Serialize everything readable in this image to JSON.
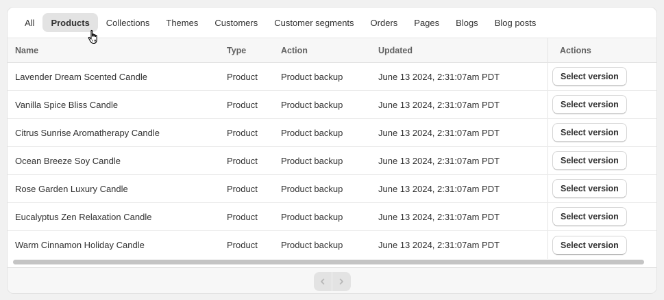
{
  "tabs": [
    {
      "label": "All",
      "active": false
    },
    {
      "label": "Products",
      "active": true
    },
    {
      "label": "Collections",
      "active": false
    },
    {
      "label": "Themes",
      "active": false
    },
    {
      "label": "Customers",
      "active": false
    },
    {
      "label": "Customer segments",
      "active": false
    },
    {
      "label": "Orders",
      "active": false
    },
    {
      "label": "Pages",
      "active": false
    },
    {
      "label": "Blogs",
      "active": false
    },
    {
      "label": "Blog posts",
      "active": false
    }
  ],
  "table": {
    "columns": {
      "name": "Name",
      "type": "Type",
      "action": "Action",
      "updated": "Updated",
      "actions": "Actions"
    },
    "rows": [
      {
        "name": "Lavender Dream Scented Candle",
        "type": "Product",
        "action": "Product backup",
        "updated": "June 13 2024, 2:31:07am PDT",
        "button": "Select version"
      },
      {
        "name": "Vanilla Spice Bliss Candle",
        "type": "Product",
        "action": "Product backup",
        "updated": "June 13 2024, 2:31:07am PDT",
        "button": "Select version"
      },
      {
        "name": "Citrus Sunrise Aromatherapy Candle",
        "type": "Product",
        "action": "Product backup",
        "updated": "June 13 2024, 2:31:07am PDT",
        "button": "Select version"
      },
      {
        "name": "Ocean Breeze Soy Candle",
        "type": "Product",
        "action": "Product backup",
        "updated": "June 13 2024, 2:31:07am PDT",
        "button": "Select version"
      },
      {
        "name": "Rose Garden Luxury Candle",
        "type": "Product",
        "action": "Product backup",
        "updated": "June 13 2024, 2:31:07am PDT",
        "button": "Select version"
      },
      {
        "name": "Eucalyptus Zen Relaxation Candle",
        "type": "Product",
        "action": "Product backup",
        "updated": "June 13 2024, 2:31:07am PDT",
        "button": "Select version"
      },
      {
        "name": "Warm Cinnamon Holiday Candle",
        "type": "Product",
        "action": "Product backup",
        "updated": "June 13 2024, 2:31:07am PDT",
        "button": "Select version"
      }
    ]
  },
  "pagination": {
    "prev_icon": "chevron-left-icon",
    "next_icon": "chevron-right-icon"
  },
  "colors": {
    "active_tab_bg": "#e3e3e3",
    "header_bg": "#f7f7f7",
    "page_bg": "#f1f1f1"
  }
}
